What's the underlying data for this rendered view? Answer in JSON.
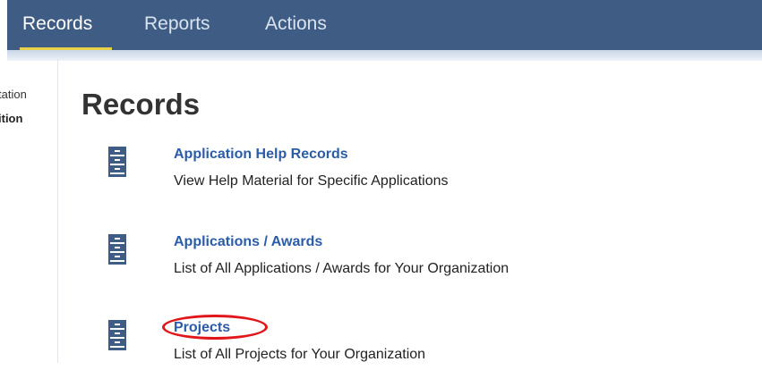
{
  "nav": {
    "tabs": [
      {
        "label": "Records",
        "active": true
      },
      {
        "label": "Reports",
        "active": false
      },
      {
        "label": "Actions",
        "active": false
      }
    ]
  },
  "sidebar": {
    "items": [
      {
        "label": "tation"
      },
      {
        "label": "ition"
      }
    ]
  },
  "page": {
    "title": "Records"
  },
  "records": [
    {
      "icon": "file-cabinet-icon",
      "title": "Application Help Records",
      "description": "View Help Material for Specific Applications"
    },
    {
      "icon": "file-cabinet-icon",
      "title": "Applications / Awards",
      "description": "List of All Applications / Awards for Your Organization"
    },
    {
      "icon": "file-cabinet-icon",
      "title": "Projects",
      "description": "List of All Projects for Your Organization"
    }
  ],
  "colors": {
    "navbar": "#3f5d84",
    "active_underline": "#e9d24a",
    "link": "#2b5ca8",
    "highlight": "#e0161b"
  }
}
